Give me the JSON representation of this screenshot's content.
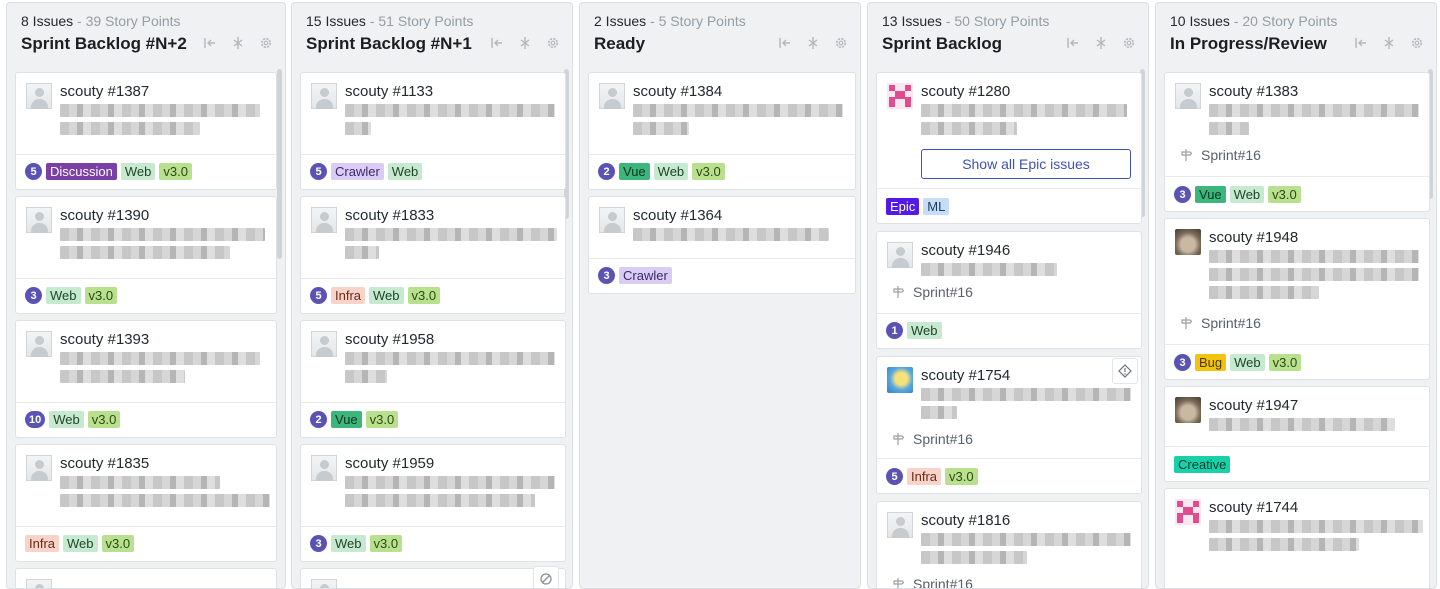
{
  "columns": [
    {
      "issues": "8 Issues",
      "points": "39 Story Points",
      "title": "Sprint Backlog #N+2",
      "cards": [
        {
          "title": "scouty #1387",
          "points": "5",
          "labels": [
            "Discussion",
            "Web",
            "v3.0"
          ]
        },
        {
          "title": "scouty #1390",
          "points": "3",
          "labels": [
            "Web",
            "v3.0"
          ]
        },
        {
          "title": "scouty #1393",
          "points": "10",
          "labels": [
            "Web",
            "v3.0"
          ]
        },
        {
          "title": "scouty #1835",
          "labels": [
            "Infra",
            "Web",
            "v3.0"
          ]
        }
      ]
    },
    {
      "issues": "15 Issues",
      "points": "51 Story Points",
      "title": "Sprint Backlog #N+1",
      "cards": [
        {
          "title": "scouty #1133",
          "points": "5",
          "labels": [
            "Crawler",
            "Web"
          ]
        },
        {
          "title": "scouty #1833",
          "points": "5",
          "labels": [
            "Infra",
            "Web",
            "v3.0"
          ]
        },
        {
          "title": "scouty #1958",
          "points": "2",
          "labels": [
            "Vue",
            "v3.0"
          ]
        },
        {
          "title": "scouty #1959",
          "points": "3",
          "labels": [
            "Web",
            "v3.0"
          ]
        }
      ]
    },
    {
      "issues": "2 Issues",
      "points": "5 Story Points",
      "title": "Ready",
      "cards": [
        {
          "title": "scouty #1384",
          "points": "2",
          "labels": [
            "Vue",
            "Web",
            "v3.0"
          ]
        },
        {
          "title": "scouty #1364",
          "points": "3",
          "labels": [
            "Crawler"
          ]
        }
      ]
    },
    {
      "issues": "13 Issues",
      "points": "50 Story Points",
      "title": "Sprint Backlog",
      "cards": [
        {
          "title": "scouty #1280",
          "button": "Show all Epic issues",
          "labels": [
            "Epic",
            "ML"
          ]
        },
        {
          "title": "scouty #1946",
          "sprint": "Sprint#16",
          "points": "1",
          "labels": [
            "Web"
          ]
        },
        {
          "title": "scouty #1754",
          "sprint": "Sprint#16",
          "points": "5",
          "labels": [
            "Infra",
            "v3.0"
          ]
        },
        {
          "title": "scouty #1816",
          "sprint": "Sprint#16"
        }
      ]
    },
    {
      "issues": "10 Issues",
      "points": "20 Story Points",
      "title": "In Progress/Review",
      "cards": [
        {
          "title": "scouty #1383",
          "sprint": "Sprint#16",
          "points": "3",
          "labels": [
            "Vue",
            "Web",
            "v3.0"
          ]
        },
        {
          "title": "scouty #1948",
          "sprint": "Sprint#16",
          "points": "3",
          "labels": [
            "Bug",
            "Web",
            "v3.0"
          ]
        },
        {
          "title": "scouty #1947",
          "labels": [
            "Creative"
          ]
        },
        {
          "title": "scouty #1744"
        }
      ]
    }
  ],
  "label_colors": {
    "Discussion": {
      "bg": "#7b3fa8",
      "fg": "#ffffff"
    },
    "Web": {
      "bg": "#c7e9cf",
      "fg": "#1e4628"
    },
    "v3.0": {
      "bg": "#b9e08f",
      "fg": "#2d4a10"
    },
    "Crawler": {
      "bg": "#d9cdf5",
      "fg": "#3b2a6b"
    },
    "Infra": {
      "bg": "#f8d3c9",
      "fg": "#6b2a1a"
    },
    "Vue": {
      "bg": "#3cb77c",
      "fg": "#0c3320"
    },
    "Epic": {
      "bg": "#5319e7",
      "fg": "#ffffff"
    },
    "ML": {
      "bg": "#c7ddf5",
      "fg": "#1b3d66"
    },
    "Bug": {
      "bg": "#f2c40f",
      "fg": "#4a3a00"
    },
    "Creative": {
      "bg": "#19d1a8",
      "fg": "#053d30"
    }
  },
  "colors": {
    "accent": "#3f51b5",
    "points_badge": "#5b53b3"
  }
}
